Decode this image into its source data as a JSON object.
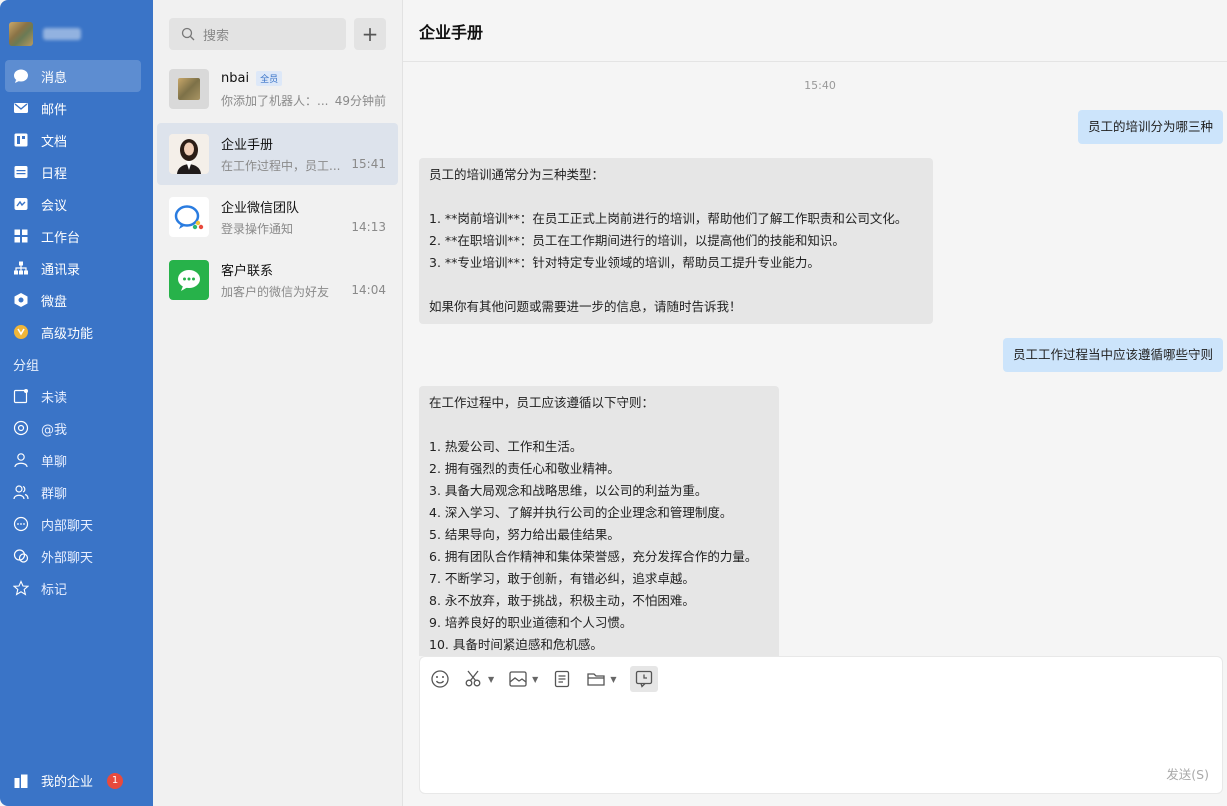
{
  "sidebar": {
    "items": [
      {
        "label": "消息",
        "icon": "chat-bubble-icon",
        "active": true
      },
      {
        "label": "邮件",
        "icon": "mail-icon"
      },
      {
        "label": "文档",
        "icon": "document-icon"
      },
      {
        "label": "日程",
        "icon": "calendar-icon"
      },
      {
        "label": "会议",
        "icon": "meeting-icon"
      },
      {
        "label": "工作台",
        "icon": "grid-icon"
      },
      {
        "label": "通讯录",
        "icon": "org-tree-icon"
      },
      {
        "label": "微盘",
        "icon": "drive-icon"
      },
      {
        "label": "高级功能",
        "icon": "premium-icon"
      }
    ],
    "group_label": "分组",
    "groups": [
      {
        "label": "未读",
        "icon": "unread-icon"
      },
      {
        "label": "@我",
        "icon": "at-icon"
      },
      {
        "label": "单聊",
        "icon": "person-icon"
      },
      {
        "label": "群聊",
        "icon": "group-icon"
      },
      {
        "label": "内部聊天",
        "icon": "internal-chat-icon"
      },
      {
        "label": "外部聊天",
        "icon": "external-chat-icon"
      },
      {
        "label": "标记",
        "icon": "star-icon"
      }
    ],
    "footer": {
      "label": "我的企业",
      "badge": "1"
    }
  },
  "search": {
    "placeholder": "搜索"
  },
  "conversations": [
    {
      "name": "nbai",
      "tag": "全员",
      "preview": "你添加了机器人：...",
      "time": "49分钟前"
    },
    {
      "name": "企业手册",
      "tag": "",
      "preview": "在工作过程中，员工...",
      "time": "15:41"
    },
    {
      "name": "企业微信团队",
      "tag": "",
      "preview": "登录操作通知",
      "time": "14:13"
    },
    {
      "name": "客户联系",
      "tag": "",
      "preview": "加客户的微信为好友",
      "time": "14:04"
    }
  ],
  "chat": {
    "title": "企业手册",
    "timestamp": "15:40",
    "messages": [
      {
        "from": "me",
        "text": "员工的培训分为哪三种"
      },
      {
        "from": "bot",
        "text": "员工的培训通常分为三种类型：\n\n1. **岗前培训**：在员工正式上岗前进行的培训，帮助他们了解工作职责和公司文化。\n2. **在职培训**：员工在工作期间进行的培训，以提高他们的技能和知识。\n3. **专业培训**：针对特定专业领域的培训，帮助员工提升专业能力。\n\n如果你有其他问题或需要进一步的信息，请随时告诉我！"
      },
      {
        "from": "me",
        "text": "员工工作过程当中应该遵循哪些守则"
      },
      {
        "from": "bot",
        "text": "在工作过程中，员工应该遵循以下守则：\n\n1. 热爱公司、工作和生活。\n2. 拥有强烈的责任心和敬业精神。\n3. 具备大局观念和战略思维，以公司的利益为重。\n4. 深入学习、了解并执行公司的企业理念和管理制度。\n5. 结果导向，努力给出最佳结果。\n6. 拥有团队合作精神和集体荣誉感，充分发挥合作的力量。\n7. 不断学习，敢于创新，有错必纠，追求卓越。\n8. 永不放弃，敢于挑战，积极主动，不怕困难。\n9. 培养良好的职业道德和个人习惯。\n10. 具备时间紧迫感和危机感。"
      }
    ]
  },
  "composer": {
    "send_label": "发送(S)"
  }
}
